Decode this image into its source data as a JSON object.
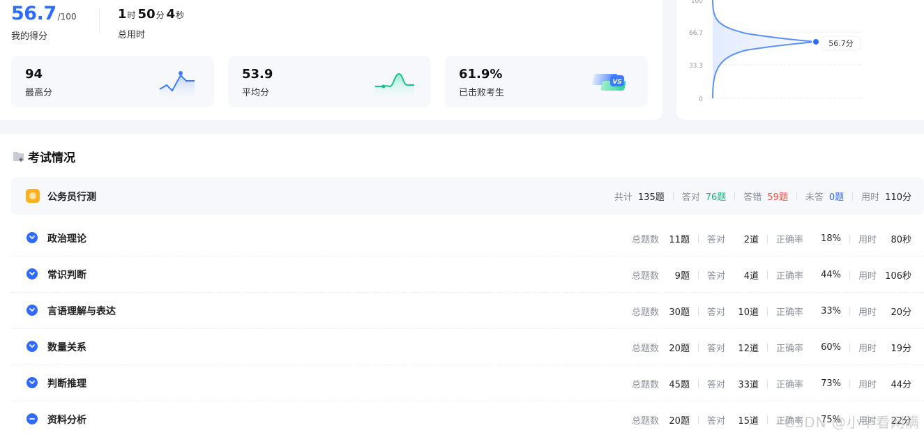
{
  "score": {
    "value": "56.7",
    "total": "/100",
    "label": "我的得分"
  },
  "time": {
    "h": "1",
    "h_unit": "时",
    "m": "50",
    "m_unit": "分",
    "s": "4",
    "s_unit": "秒",
    "label": "总用时"
  },
  "stats": [
    {
      "value": "94",
      "label": "最高分",
      "icon": "peak-line-icon"
    },
    {
      "value": "53.9",
      "label": "平均分",
      "icon": "average-wave-icon"
    },
    {
      "value": "61.9%",
      "label": "已击败考生",
      "icon": "versus-icon"
    }
  ],
  "distribution": {
    "y_ticks": [
      "100",
      "66.7",
      "33.3",
      "0"
    ],
    "marker_label": "56.7分",
    "marker_value": 56.7,
    "curve_color": "#5b8ff9"
  },
  "section": {
    "title": "考试情况"
  },
  "summary": {
    "name": "公务员行测",
    "total_k": "共计",
    "total_v": "135题",
    "correct_k": "答对",
    "correct_v": "76题",
    "wrong_k": "答错",
    "wrong_v": "59题",
    "unanswered_k": "未答",
    "unanswered_v": "0题",
    "time_k": "用时",
    "time_v": "110分"
  },
  "labels": {
    "total": "总题数",
    "correct": "答对",
    "rate": "正确率",
    "time": "用时"
  },
  "rows": [
    {
      "name": "政治理论",
      "total": "11题",
      "correct": "2道",
      "rate": "18%",
      "time": "80秒"
    },
    {
      "name": "常识判断",
      "total": "9题",
      "correct": "4道",
      "rate": "44%",
      "time": "106秒"
    },
    {
      "name": "言语理解与表达",
      "total": "30题",
      "correct": "10道",
      "rate": "33%",
      "time": "20分"
    },
    {
      "name": "数量关系",
      "total": "20题",
      "correct": "12道",
      "rate": "60%",
      "time": "19分"
    },
    {
      "name": "判断推理",
      "total": "45题",
      "correct": "33道",
      "rate": "73%",
      "time": "44分"
    },
    {
      "name": "资料分析",
      "total": "20题",
      "correct": "15道",
      "rate": "75%",
      "time": "22分"
    }
  ],
  "watermark": "CSDN @小卒看网瞒"
}
